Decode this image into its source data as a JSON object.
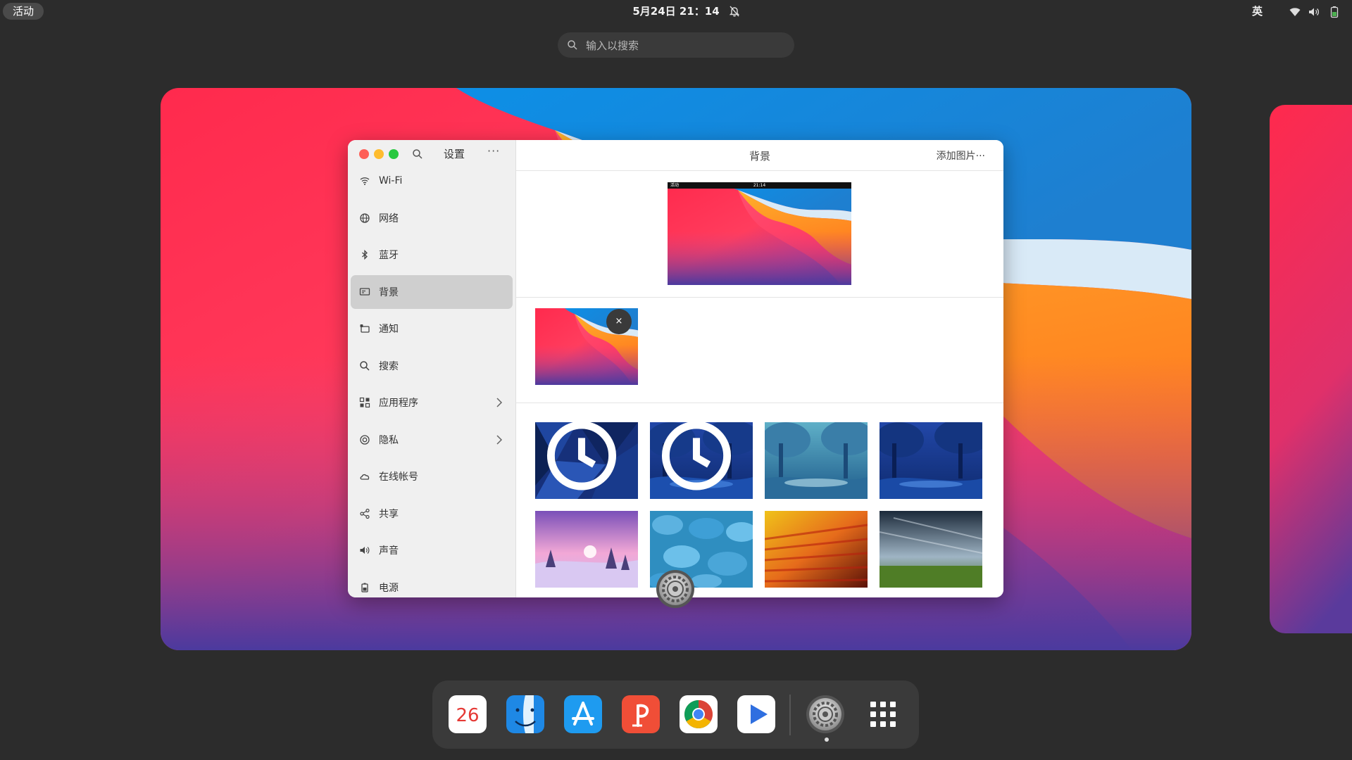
{
  "topbar": {
    "activities_label": "活动",
    "clock": "5月24日  21：14",
    "input_method": "英",
    "icons": [
      "bell-off-icon",
      "wifi-icon",
      "volume-icon",
      "battery-icon"
    ]
  },
  "overview_search": {
    "placeholder": "输入以搜索"
  },
  "settings": {
    "sidebar_title": "设置",
    "more_label": "···",
    "items": [
      {
        "label": "Wi-Fi",
        "icon": "wifi-icon"
      },
      {
        "label": "网络",
        "icon": "network-globe-icon"
      },
      {
        "label": "蓝牙",
        "icon": "bluetooth-icon"
      },
      {
        "label": "背景",
        "icon": "background-icon",
        "active": true
      },
      {
        "label": "通知",
        "icon": "notification-icon"
      },
      {
        "label": "搜索",
        "icon": "search-icon"
      },
      {
        "label": "应用程序",
        "icon": "apps-grid-icon",
        "chevron": true
      },
      {
        "label": "隐私",
        "icon": "privacy-icon",
        "chevron": true
      },
      {
        "label": "在线帐号",
        "icon": "cloud-icon"
      },
      {
        "label": "共享",
        "icon": "share-icon"
      },
      {
        "label": "声音",
        "icon": "sound-icon"
      },
      {
        "label": "电源",
        "icon": "power-icon"
      }
    ],
    "main_title": "背景",
    "add_button": "添加图片···",
    "preview_bar": {
      "left": "活动",
      "center": "21:14"
    },
    "remove_label": "×"
  },
  "colors": {
    "accent_red": "#fe5f57",
    "accent_yellow": "#febc2e",
    "accent_green": "#28c840",
    "sidebar_active": "#cfcfcf",
    "desktop_bg": "#2c2c2c"
  },
  "dock": {
    "calendar_day": "26",
    "apps": [
      "calendar-app",
      "finder-app",
      "app-store-app",
      "presentation-app",
      "chrome-app",
      "video-player-app",
      "settings-app",
      "app-grid-icon"
    ]
  }
}
